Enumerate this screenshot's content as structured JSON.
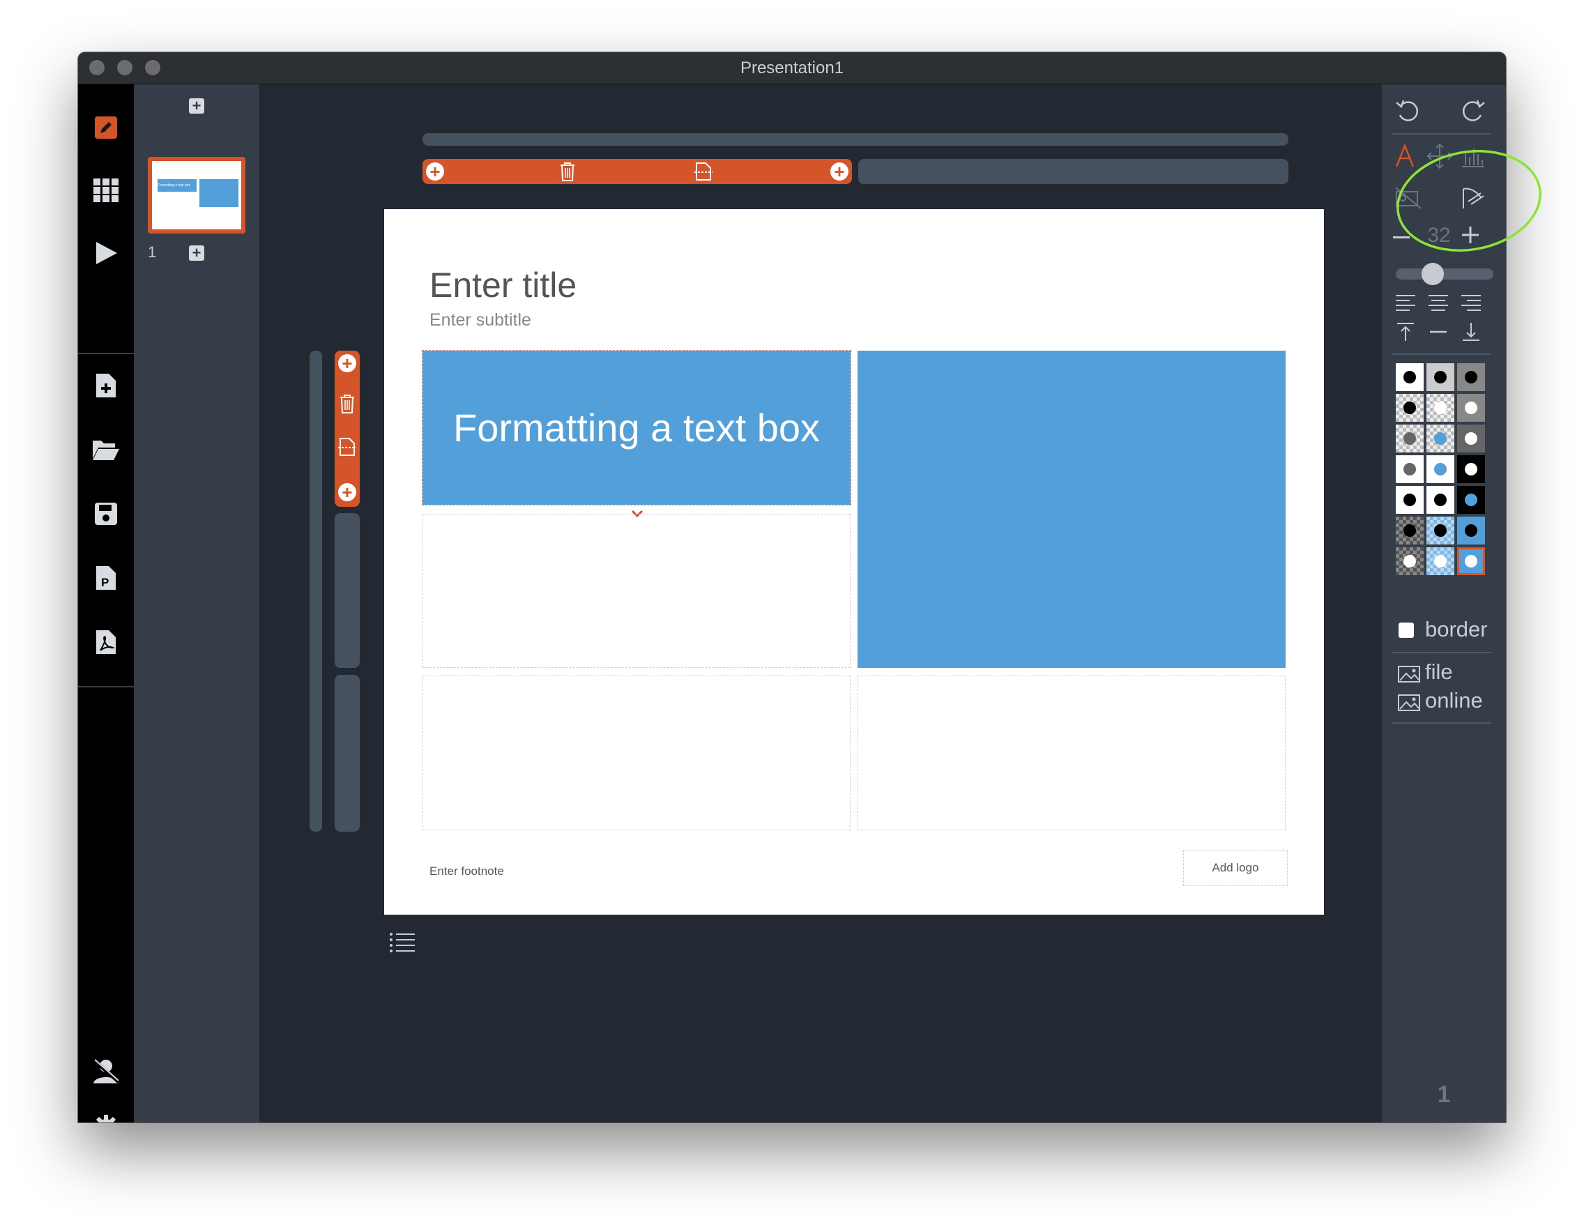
{
  "window": {
    "title": "Presentation1"
  },
  "left_toolbar": {
    "items": [
      "edit-icon",
      "grid-icon",
      "play-icon",
      "new-file-icon",
      "open-folder-icon",
      "save-icon",
      "export-pptx-icon",
      "export-pdf-icon",
      "user-off-icon",
      "settings-icon"
    ]
  },
  "slides_panel": {
    "slide_numbers": [
      "1"
    ],
    "thumb_text": "Formatting a text box"
  },
  "slide": {
    "title_placeholder": "Enter title",
    "subtitle_placeholder": "Enter subtitle",
    "text_box": "Formatting a text box",
    "footnote_placeholder": "Enter footnote",
    "logo_button": "Add logo"
  },
  "format_panel": {
    "font_size": "32",
    "border_label": "border",
    "image_file_label": "file",
    "image_online_label": "online",
    "page_number": "1",
    "swatches": [
      [
        {
          "bg": "#ffffff",
          "dot": "#000000"
        },
        {
          "bg": "#cccccc",
          "dot": "#000000"
        },
        {
          "bg": "#888888",
          "dot": "#000000"
        }
      ],
      [
        {
          "bg": "checker",
          "dot": "#000000"
        },
        {
          "bg": "checker",
          "dot": "#ffffff"
        },
        {
          "bg": "#888888",
          "dot": "#ffffff"
        }
      ],
      [
        {
          "bg": "checker",
          "dot": "#666666"
        },
        {
          "bg": "checker",
          "dot": "#529fd9"
        },
        {
          "bg": "#666666",
          "dot": "#ffffff"
        }
      ],
      [
        {
          "bg": "#ffffff",
          "dot": "#666666"
        },
        {
          "bg": "#ffffff",
          "dot": "#529fd9"
        },
        {
          "bg": "#000000",
          "dot": "#ffffff"
        }
      ],
      [
        {
          "bg": "#ffffff",
          "dot": "#000000"
        },
        {
          "bg": "#ffffff",
          "dot": "#000000"
        },
        {
          "bg": "#000000",
          "dot": "#529fd9"
        }
      ],
      [
        {
          "bg": "checker-dark",
          "dot": "#000000"
        },
        {
          "bg": "checker-blue",
          "dot": "#000000"
        },
        {
          "bg": "#529fd9",
          "dot": "#000000"
        }
      ],
      [
        {
          "bg": "checker-dark",
          "dot": "#ffffff"
        },
        {
          "bg": "checker-blue",
          "dot": "#ffffff"
        },
        {
          "bg": "#529fd9",
          "dot": "#ffffff",
          "selected": true
        }
      ]
    ]
  },
  "colors": {
    "accent": "#d4552a",
    "box_blue": "#529fd9",
    "annotation": "#8de33a"
  }
}
